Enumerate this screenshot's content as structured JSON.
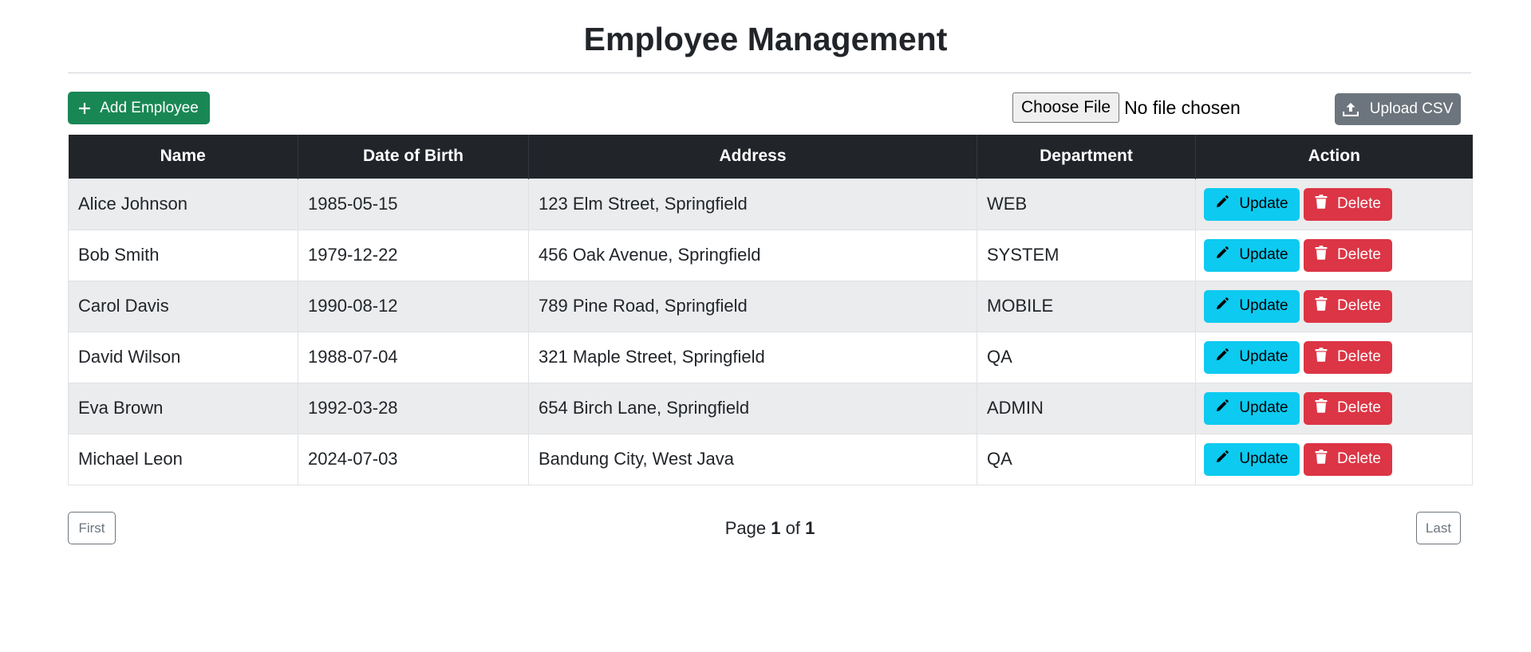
{
  "page": {
    "title": "Employee Management"
  },
  "toolbar": {
    "add_label": "Add Employee",
    "file_button_label": "Choose File",
    "file_status": "No file chosen",
    "upload_label": "Upload CSV"
  },
  "table": {
    "columns": [
      "Name",
      "Date of Birth",
      "Address",
      "Department",
      "Action"
    ],
    "rows": [
      {
        "name": "Alice Johnson",
        "dob": "1985-05-15",
        "address": "123 Elm Street, Springfield",
        "department": "WEB"
      },
      {
        "name": "Bob Smith",
        "dob": "1979-12-22",
        "address": "456 Oak Avenue, Springfield",
        "department": "SYSTEM"
      },
      {
        "name": "Carol Davis",
        "dob": "1990-08-12",
        "address": "789 Pine Road, Springfield",
        "department": "MOBILE"
      },
      {
        "name": "David Wilson",
        "dob": "1988-07-04",
        "address": "321 Maple Street, Springfield",
        "department": "QA"
      },
      {
        "name": "Eva Brown",
        "dob": "1992-03-28",
        "address": "654 Birch Lane, Springfield",
        "department": "ADMIN"
      },
      {
        "name": "Michael Leon",
        "dob": "2024-07-03",
        "address": "Bandung City, West Java",
        "department": "QA"
      }
    ],
    "update_label": "Update",
    "delete_label": "Delete"
  },
  "pagination": {
    "first_label": "First",
    "last_label": "Last",
    "page_word": "Page",
    "of_word": "of",
    "current": "1",
    "total": "1"
  },
  "icons": {
    "add": "plus-icon",
    "upload": "upload-icon",
    "update": "pencil-icon",
    "delete": "trash-icon"
  },
  "colors": {
    "add_button": "#198754",
    "upload_button": "#6c757d",
    "update_button": "#0dcaf0",
    "delete_button": "#dc3545",
    "table_header": "#212529"
  }
}
